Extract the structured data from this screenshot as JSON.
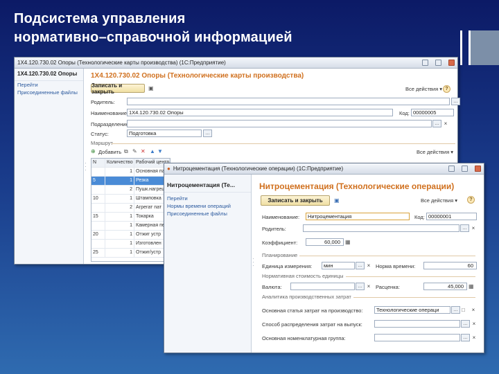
{
  "slide": {
    "title_line1": "Подсистема управления",
    "title_line2": "нормативно–справочной информацией"
  },
  "back_window": {
    "titlebar": "1Х4.120.730.02 Опоры (Технологические карты производства) (1С:Предприятие)",
    "nav": {
      "header": "1Х4.120.730.02 Опоры",
      "items": [
        "Перейти",
        "Присоединенные файлы"
      ]
    },
    "heading": "1Х4.120.730.02 Опоры (Технологические карты производства)",
    "save_label": "Записать и закрыть",
    "all_actions": "Все действия ▾",
    "fields": {
      "parent_label": "Родитель:",
      "parent_value": "",
      "name_label": "Наименование:",
      "name_value": "1Х4.120.730.02 Опоры",
      "code_label": "Код:",
      "code_value": "00000005",
      "division_label": "Подразделение:",
      "division_value": "",
      "status_label": "Статус:",
      "status_value": "Подготовка"
    },
    "group_label": "Маршрут",
    "add_label": "Добавить",
    "all_actions2": "Все действия ▾",
    "table": {
      "headers": [
        "N",
        "Количество",
        "Рабочий центр"
      ],
      "rows": [
        {
          "n": "",
          "qty": "1",
          "op": "Основная пал",
          "sel": false
        },
        {
          "n": "5",
          "qty": "1",
          "op": "Резка",
          "sel": true
        },
        {
          "n": "",
          "qty": "2",
          "op": "Пушк.нагреш",
          "sel": false
        },
        {
          "n": "10",
          "qty": "1",
          "op": "Штамповка",
          "sel": false
        },
        {
          "n": "",
          "qty": "2",
          "op": "Агрегат пат",
          "sel": false
        },
        {
          "n": "15",
          "qty": "1",
          "op": "Токарка",
          "sel": false
        },
        {
          "n": "",
          "qty": "1",
          "op": "Камерная пе",
          "sel": false
        },
        {
          "n": "20",
          "qty": "1",
          "op": "Отжиг устр",
          "sel": false
        },
        {
          "n": "",
          "qty": "1",
          "op": "Изготовлен",
          "sel": false
        },
        {
          "n": "25",
          "qty": "1",
          "op": "Отжиг/устр",
          "sel": false
        }
      ]
    }
  },
  "front_window": {
    "titlebar": "Нитроцементация (Технологические операции) (1С:Предприятие)",
    "nav": {
      "header": "Нитроцементация (Те...",
      "items": [
        "Перейти",
        "Нормы времени операций",
        "Присоединенные файлы"
      ]
    },
    "heading": "Нитроцементация (Технологические операции)",
    "save_label": "Записать и закрыть",
    "all_actions": "Все действия ▾",
    "help": "?",
    "fields": {
      "name_label": "Наименование:",
      "name_value": "Нитроцементация",
      "code_label": "Код:",
      "code_value": "00000001",
      "parent_label": "Родитель:",
      "parent_value": "",
      "coef_label": "Коэффициент:",
      "coef_value": "60,000"
    },
    "sections": {
      "planning": "Планирование",
      "cost": "Нормативная стоимость единицы",
      "analytics": "Аналитика производственных затрат"
    },
    "planning": {
      "unit_label": "Единица измерения:",
      "unit_value": "мин",
      "time_label": "Норма времени:",
      "time_value": "60"
    },
    "cost": {
      "currency_label": "Валюта:",
      "currency_value": "",
      "rate_label": "Расценка:",
      "rate_value": "45,000"
    },
    "analytics": {
      "item_label": "Основная статья затрат на производство:",
      "item_value": "Технологические операци",
      "method_label": "Способ распределения затрат на выпуск:",
      "method_value": "",
      "group_label": "Основная номенклатурная группа:",
      "group_value": ""
    }
  },
  "icons": {
    "select": "…",
    "clear": "×",
    "open": "□",
    "calc": "▦",
    "save_disk": "💾"
  }
}
